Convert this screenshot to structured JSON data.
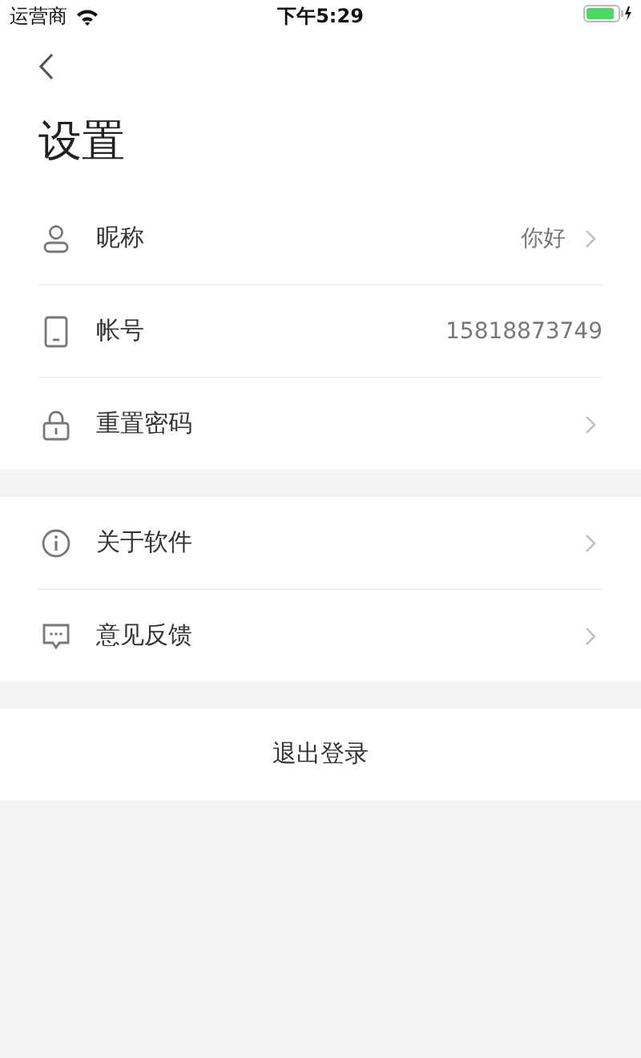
{
  "status_bar": {
    "carrier": "运营商",
    "time": "下午5:29"
  },
  "title": "设置",
  "groups": [
    {
      "rows": [
        {
          "label": "昵称",
          "value": "你好",
          "disclosure": true
        },
        {
          "label": "帐号",
          "value": "15818873749",
          "disclosure": false
        },
        {
          "label": "重置密码",
          "disclosure": true
        }
      ]
    },
    {
      "rows": [
        {
          "label": "关于软件",
          "disclosure": true
        },
        {
          "label": "意见反馈",
          "disclosure": true
        }
      ]
    }
  ],
  "logout": "退出登录"
}
